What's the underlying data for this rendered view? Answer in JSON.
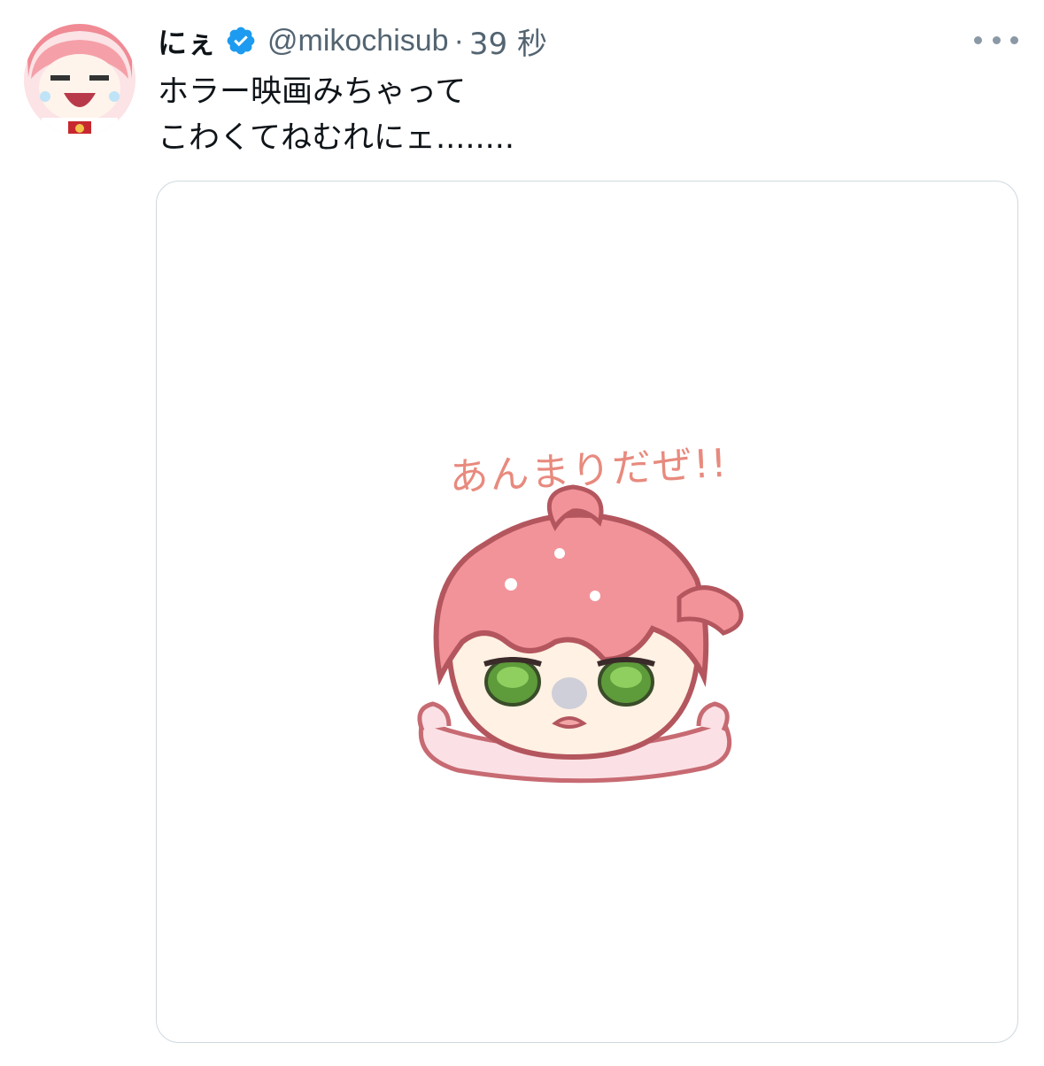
{
  "tweet": {
    "display_name": "にぇ",
    "handle": "@mikochisub",
    "separator": "·",
    "time": "39 秒",
    "text_lines": [
      "ホラー映画みちゃって",
      "こわくてねむれにェ........"
    ],
    "verified_icon": "verified-badge-icon",
    "more_icon": "more-dots-icon",
    "media": {
      "caption": "あんまりだぜ!!",
      "description_icon": "sad-character-illustration"
    }
  },
  "colors": {
    "text_primary": "#0f1419",
    "text_secondary": "#536471",
    "verified_blue": "#1d9bf0",
    "border": "#cfd9de",
    "caption_pink": "#e88a7e"
  }
}
